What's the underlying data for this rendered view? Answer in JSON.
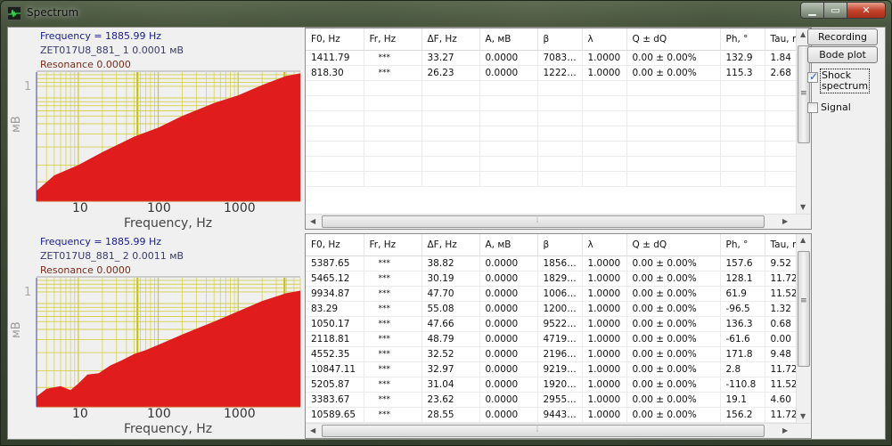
{
  "window": {
    "title": "Spectrum",
    "icon": "spectrum-waveform-icon",
    "caption_buttons": [
      "minimize-icon",
      "maximize-icon",
      "close-icon"
    ]
  },
  "plots": [
    {
      "frequency_label": "Frequency = 1885.99 Hz",
      "channel_label": "ZET017U8_881_ 1  0.0001 мВ",
      "resonance_label": "Resonance  0.0000"
    },
    {
      "frequency_label": "Frequency = 1885.99 Hz",
      "channel_label": "ZET017U8_881_ 2  0.0011 мВ",
      "resonance_label": "Resonance  0.0000"
    }
  ],
  "chart_data": [
    {
      "type": "area",
      "title": "",
      "xlabel": "Frequency, Hz",
      "ylabel": "мВ",
      "x_scale": "log",
      "y_scale": "log",
      "x_ticks": [
        "10",
        "100",
        "1000"
      ],
      "y_ticks": [
        "1"
      ],
      "xlim": [
        3,
        6000
      ],
      "grid": true,
      "series": [
        {
          "name": "ZET017U8_881_ 1",
          "color": "#e01c1c",
          "x": [
            3,
            5,
            10,
            20,
            50,
            100,
            200,
            500,
            1000,
            2000,
            4000,
            6000
          ],
          "y_fraction_of_height": [
            0.08,
            0.2,
            0.28,
            0.38,
            0.5,
            0.57,
            0.66,
            0.76,
            0.82,
            0.9,
            0.97,
            0.99
          ]
        }
      ]
    },
    {
      "type": "area",
      "title": "",
      "xlabel": "Frequency, Hz",
      "ylabel": "мВ",
      "x_scale": "log",
      "y_scale": "log",
      "x_ticks": [
        "10",
        "100",
        "1000"
      ],
      "y_ticks": [
        "1"
      ],
      "xlim": [
        3,
        6000
      ],
      "grid": true,
      "series": [
        {
          "name": "ZET017U8_881_ 2",
          "color": "#e01c1c",
          "x": [
            3,
            4,
            6,
            8,
            10,
            13,
            18,
            25,
            35,
            50,
            70,
            100,
            200,
            500,
            1000,
            2000,
            4000,
            6000
          ],
          "y_fraction_of_height": [
            0.08,
            0.14,
            0.16,
            0.13,
            0.18,
            0.25,
            0.26,
            0.32,
            0.36,
            0.41,
            0.44,
            0.48,
            0.56,
            0.66,
            0.74,
            0.82,
            0.88,
            0.9
          ]
        }
      ]
    }
  ],
  "tables": {
    "columns": [
      "F0, Hz",
      "Fr, Hz",
      "ΔF, Hz",
      "A, мВ",
      "β",
      "λ",
      "Q ± dQ",
      "Ph, °",
      "Tau, r"
    ],
    "top_rows": [
      [
        "1411.79",
        "***",
        "33.27",
        "0.0000",
        "7083…",
        "1.0000",
        "0.00 ± 0.00%",
        "132.9",
        "1.84"
      ],
      [
        "818.30",
        "***",
        "26.23",
        "0.0000",
        "1222…",
        "1.0000",
        "0.00 ± 0.00%",
        "115.3",
        "2.68"
      ]
    ],
    "bottom_rows": [
      [
        "5387.65",
        "***",
        "38.82",
        "0.0000",
        "1856…",
        "1.0000",
        "0.00 ± 0.00%",
        "157.6",
        "9.52"
      ],
      [
        "5465.12",
        "***",
        "30.19",
        "0.0000",
        "1829…",
        "1.0000",
        "0.00 ± 0.00%",
        "128.1",
        "11.72"
      ],
      [
        "9934.87",
        "***",
        "47.70",
        "0.0000",
        "1006…",
        "1.0000",
        "0.00 ± 0.00%",
        "61.9",
        "11.52"
      ],
      [
        "83.29",
        "***",
        "55.08",
        "0.0000",
        "1200…",
        "1.0000",
        "0.00 ± 0.00%",
        "-96.5",
        "1.32"
      ],
      [
        "1050.17",
        "***",
        "47.66",
        "0.0000",
        "9522…",
        "1.0000",
        "0.00 ± 0.00%",
        "136.3",
        "0.68"
      ],
      [
        "2118.81",
        "***",
        "48.79",
        "0.0000",
        "4719…",
        "1.0000",
        "0.00 ± 0.00%",
        "-61.6",
        "0.00"
      ],
      [
        "4552.35",
        "***",
        "32.52",
        "0.0000",
        "2196…",
        "1.0000",
        "0.00 ± 0.00%",
        "171.8",
        "9.48"
      ],
      [
        "10847.11",
        "***",
        "32.97",
        "0.0000",
        "9219…",
        "1.0000",
        "0.00 ± 0.00%",
        "2.8",
        "11.72"
      ],
      [
        "5205.87",
        "***",
        "31.04",
        "0.0000",
        "1920…",
        "1.0000",
        "0.00 ± 0.00%",
        "-110.8",
        "11.52"
      ],
      [
        "3383.67",
        "***",
        "23.62",
        "0.0000",
        "2955…",
        "1.0000",
        "0.00 ± 0.00%",
        "19.1",
        "4.60"
      ],
      [
        "10589.65",
        "***",
        "28.55",
        "0.0000",
        "9443…",
        "1.0000",
        "0.00 ± 0.00%",
        "156.2",
        "11.72"
      ]
    ]
  },
  "controls": {
    "recording_label": "Recording",
    "bode_plot_label": "Bode plot",
    "shock_spectrum_label_1": "Shock",
    "shock_spectrum_label_2": "spectrum",
    "shock_spectrum_checked": true,
    "signal_label": "Signal",
    "signal_checked": false
  }
}
